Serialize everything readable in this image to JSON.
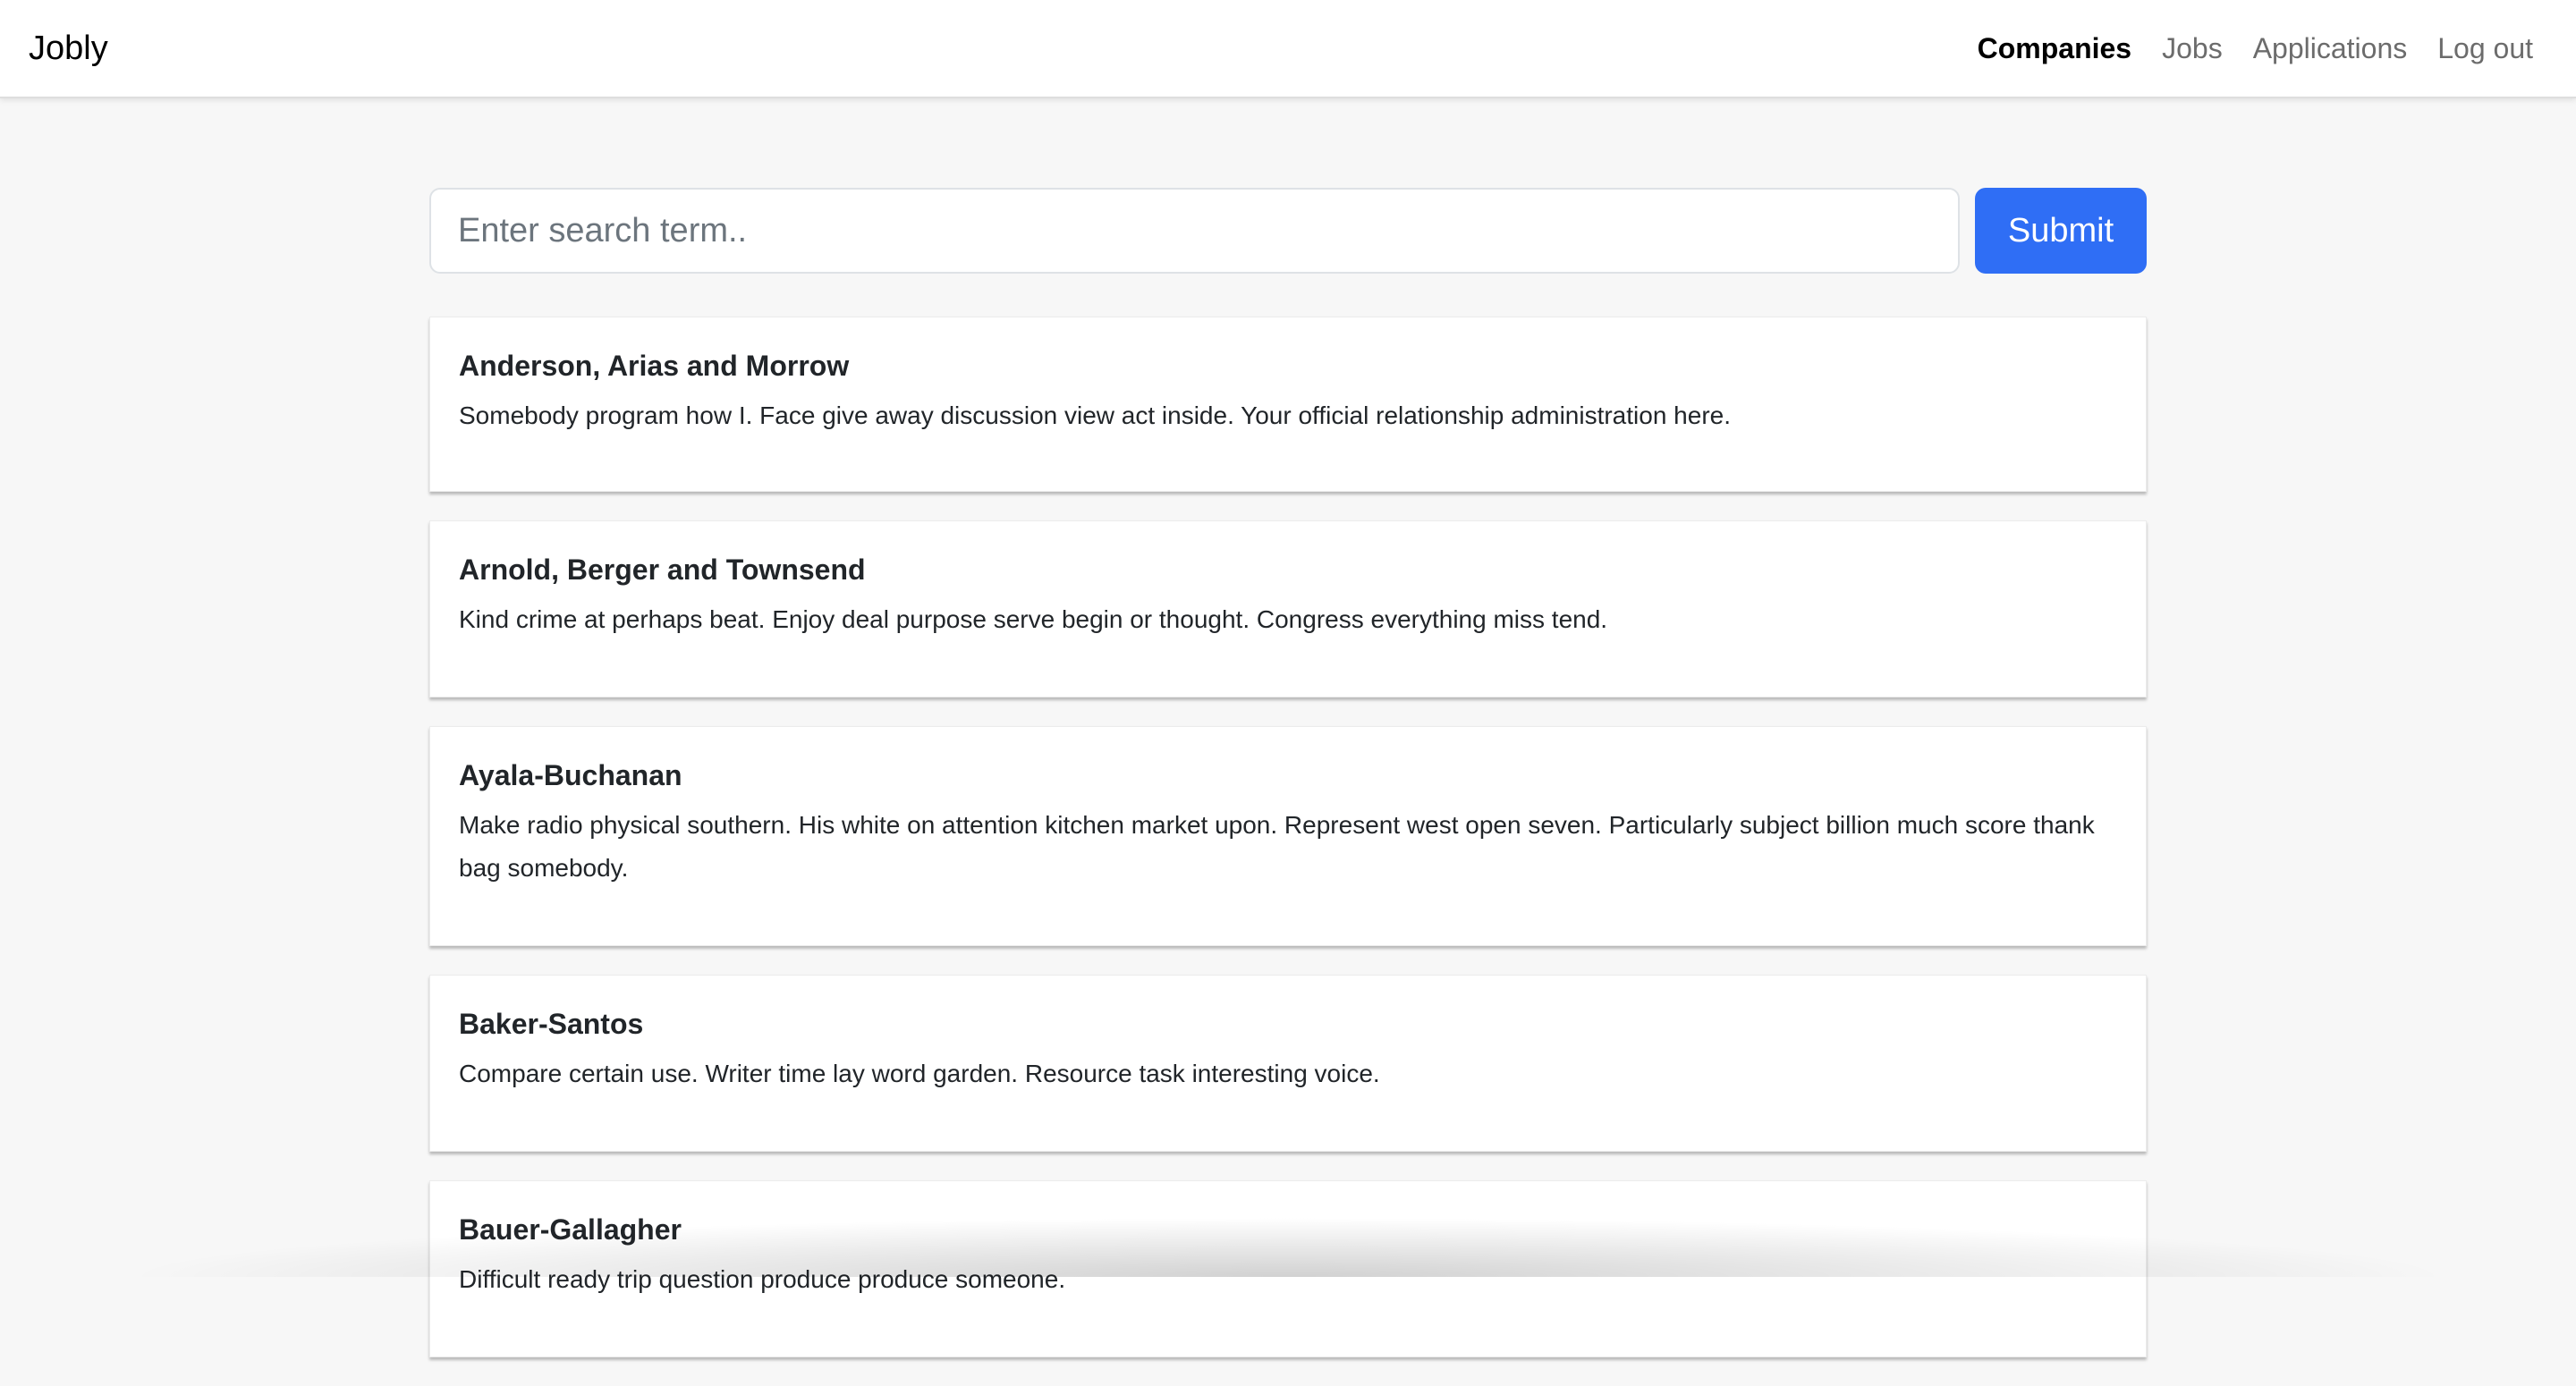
{
  "navbar": {
    "brand": "Jobly",
    "links": [
      {
        "label": "Companies",
        "active": true
      },
      {
        "label": "Jobs",
        "active": false
      },
      {
        "label": "Applications",
        "active": false
      },
      {
        "label": "Log out",
        "active": false
      }
    ]
  },
  "search": {
    "placeholder": "Enter search term..",
    "value": "",
    "submit_label": "Submit"
  },
  "companies": [
    {
      "name": "Anderson, Arias and Morrow",
      "description": "Somebody program how I. Face give away discussion view act inside. Your official relationship administration here."
    },
    {
      "name": "Arnold, Berger and Townsend",
      "description": "Kind crime at perhaps beat. Enjoy deal purpose serve begin or thought. Congress everything miss tend."
    },
    {
      "name": "Ayala-Buchanan",
      "description": "Make radio physical southern. His white on attention kitchen market upon. Represent west open seven. Particularly subject billion much score thank bag somebody."
    },
    {
      "name": "Baker-Santos",
      "description": "Compare certain use. Writer time lay word garden. Resource task interesting voice."
    },
    {
      "name": "Bauer-Gallagher",
      "description": "Difficult ready trip question produce produce someone."
    }
  ],
  "colors": {
    "primary": "#2f6ef5",
    "background": "#f7f7f7",
    "card": "#ffffff",
    "text": "#212529",
    "nav_muted": "#6c6c6c"
  }
}
